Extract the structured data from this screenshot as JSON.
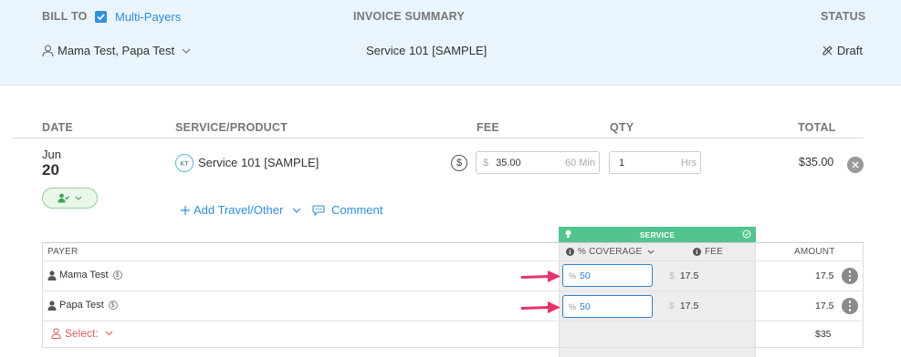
{
  "header": {
    "bill_to": "BILL TO",
    "multi_payers_label": "Multi-Payers",
    "multi_payers_checked": true,
    "invoice_summary": "INVOICE SUMMARY",
    "status_label": "STATUS",
    "payers": "Mama Test, Papa Test",
    "summary_value": "Service 101 [SAMPLE]",
    "status_value": "Draft"
  },
  "columns": {
    "date": "DATE",
    "service": "SERVICE/PRODUCT",
    "fee": "FEE",
    "qty": "QTY",
    "total": "TOTAL"
  },
  "line_item": {
    "month": "Jun",
    "day": "20",
    "provider_initials": "KT",
    "service_name": "Service 101 [SAMPLE]",
    "fee_prefix": "$",
    "fee_value": "35.00",
    "fee_suffix": "60 Min",
    "qty_value": "1",
    "qty_suffix": "Hrs",
    "total": "$35.00",
    "add_travel": "Add Travel/Other",
    "comment": "Comment"
  },
  "payer_table": {
    "service_header": "SERVICE",
    "col_payer": "PAYER",
    "col_coverage": "% COVERAGE",
    "col_fee": "FEE",
    "col_amount": "AMOUNT",
    "rows": [
      {
        "name": "Mama Test",
        "coverage": "50",
        "fee": "17.5",
        "amount": "17.5"
      },
      {
        "name": "Papa Test",
        "coverage": "50",
        "fee": "17.5",
        "amount": "17.5"
      }
    ],
    "select_label": "Select:",
    "select_total": "$35"
  },
  "colors": {
    "accent_blue": "#2f8fdc",
    "service_green": "#52c48f",
    "alert_red": "#e05a5a",
    "arrow_pink": "#e8336d"
  }
}
